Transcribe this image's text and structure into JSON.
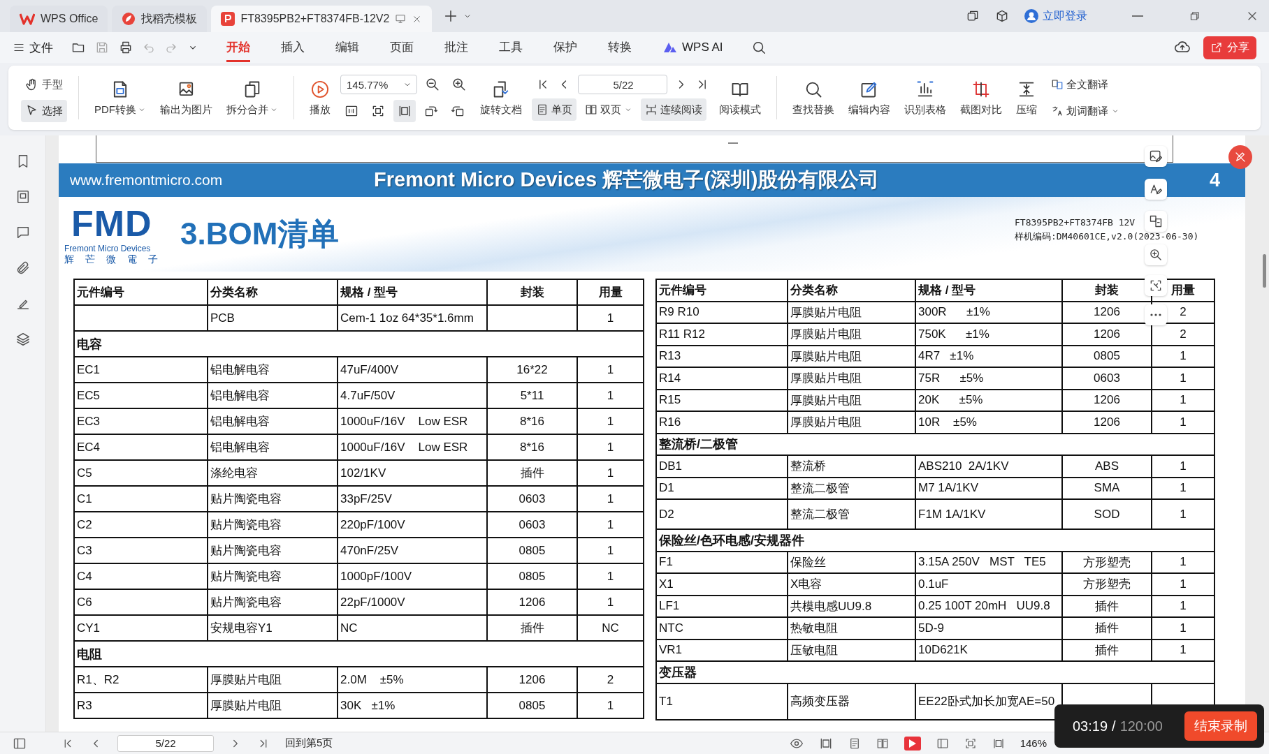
{
  "tabs": [
    {
      "label": "WPS Office",
      "kind": "home",
      "selected": false
    },
    {
      "label": "找稻壳模板",
      "kind": "template",
      "selected": false
    },
    {
      "label": "FT8395PB2+FT8374FB-12V2",
      "kind": "document",
      "selected": true
    }
  ],
  "account": "立即登录",
  "menu": {
    "file": "文件",
    "tabs": [
      {
        "label": "开始",
        "selected": true
      },
      {
        "label": "插入",
        "selected": false
      },
      {
        "label": "编辑",
        "selected": false
      },
      {
        "label": "页面",
        "selected": false
      },
      {
        "label": "批注",
        "selected": false
      },
      {
        "label": "工具",
        "selected": false
      },
      {
        "label": "保护",
        "selected": false
      },
      {
        "label": "转换",
        "selected": false
      }
    ],
    "ai": "WPS AI",
    "share": "分享"
  },
  "toolbar": {
    "pointer_tools": [
      {
        "label": "手型",
        "selected": false
      },
      {
        "label": "选择",
        "selected": true
      }
    ],
    "convert_tools": [
      {
        "label": "PDF转换",
        "dropdown": true
      },
      {
        "label": "输出为图片",
        "dropdown": false
      },
      {
        "label": "拆分合并",
        "dropdown": true
      }
    ],
    "play": "播放",
    "zoom": "145.77%",
    "fit_buttons": [
      {
        "selected": false
      },
      {
        "selected": false
      },
      {
        "selected": true
      },
      {
        "selected": false
      },
      {
        "selected": false
      }
    ],
    "rotate": "旋转文档",
    "page": "5/22",
    "view_modes": [
      {
        "label": "单页",
        "selected": true,
        "dropdown": false
      },
      {
        "label": "双页",
        "selected": false,
        "dropdown": true
      },
      {
        "label": "连续阅读",
        "selected": true,
        "dropdown": false
      }
    ],
    "reading_mode": "阅读模式",
    "edit_tools": [
      {
        "label": "查找替换"
      },
      {
        "label": "编辑内容"
      },
      {
        "label": "识别表格"
      },
      {
        "label": "截图对比"
      },
      {
        "label": "压缩"
      }
    ],
    "translate_tools": [
      {
        "label": "全文翻译",
        "dropdown": false
      },
      {
        "label": "划词翻译",
        "dropdown": true
      }
    ]
  },
  "document": {
    "website": "www.fremontmicro.com",
    "company": "Fremont Micro Devices 辉芒微电子(深圳)股份有限公司",
    "page_number": "4",
    "logo": {
      "mark": "FMD",
      "name": "Fremont Micro Devices",
      "chinese": "辉 芒 微 電 子"
    },
    "title": "3.BOM清单",
    "model": "FT8395PB2+FT8374FB 12V",
    "sample_code": "样机编码:DM40601CE,v2.0(2023-06-30)",
    "tables": [
      {
        "columns": [
          "元件编号",
          "分类名称",
          "规格 / 型号",
          "封装",
          "用量"
        ],
        "rows": [
          {
            "kind": "item",
            "cells": [
              "",
              "PCB",
              "Cem-1 1oz 64*35*1.6mm",
              "",
              "1"
            ]
          },
          {
            "kind": "section",
            "label": "电容"
          },
          {
            "kind": "item",
            "cells": [
              "EC1",
              "铝电解电容",
              "47uF/400V",
              "16*22",
              "1"
            ]
          },
          {
            "kind": "item",
            "cells": [
              "EC5",
              "铝电解电容",
              "4.7uF/50V",
              "5*11",
              "1"
            ]
          },
          {
            "kind": "item",
            "cells": [
              "EC3",
              "铝电解电容",
              "1000uF/16V    Low ESR",
              "8*16",
              "1"
            ]
          },
          {
            "kind": "item",
            "cells": [
              "EC4",
              "铝电解电容",
              "1000uF/16V    Low ESR",
              "8*16",
              "1"
            ]
          },
          {
            "kind": "item",
            "cells": [
              "C5",
              "涤纶电容",
              "102/1KV",
              "插件",
              "1"
            ]
          },
          {
            "kind": "item",
            "cells": [
              "C1",
              "贴片陶瓷电容",
              "33pF/25V",
              "0603",
              "1"
            ]
          },
          {
            "kind": "item",
            "cells": [
              "C2",
              "贴片陶瓷电容",
              "220pF/100V",
              "0603",
              "1"
            ]
          },
          {
            "kind": "item",
            "cells": [
              "C3",
              "贴片陶瓷电容",
              "470nF/25V",
              "0805",
              "1"
            ]
          },
          {
            "kind": "item",
            "cells": [
              "C4",
              "贴片陶瓷电容",
              "1000pF/100V",
              "0805",
              "1"
            ]
          },
          {
            "kind": "item",
            "cells": [
              "C6",
              "贴片陶瓷电容",
              "22pF/1000V",
              "1206",
              "1"
            ]
          },
          {
            "kind": "item",
            "cells": [
              "CY1",
              "安规电容Y1",
              "NC",
              "插件",
              "NC"
            ]
          },
          {
            "kind": "section",
            "label": "电阻"
          },
          {
            "kind": "item",
            "cells": [
              "R1、R2",
              "厚膜贴片电阻",
              "2.0M    ±5%",
              "1206",
              "2"
            ]
          },
          {
            "kind": "item",
            "cells": [
              "R3",
              "厚膜贴片电阻",
              "30K   ±1%",
              "0805",
              "1"
            ]
          }
        ]
      },
      {
        "columns": [
          "元件编号",
          "分类名称",
          "规格 / 型号",
          "封装",
          "用量"
        ],
        "rows": [
          {
            "kind": "item",
            "cells": [
              "R9 R10",
              "厚膜贴片电阻",
              "300R      ±1%",
              "1206",
              "2"
            ]
          },
          {
            "kind": "item",
            "cells": [
              "R11 R12",
              "厚膜贴片电阻",
              "750K      ±1%",
              "1206",
              "2"
            ]
          },
          {
            "kind": "item",
            "cells": [
              "R13",
              "厚膜贴片电阻",
              "4R7   ±1%",
              "0805",
              "1"
            ]
          },
          {
            "kind": "item",
            "cells": [
              "R14",
              "厚膜贴片电阻",
              "75R      ±5%",
              "0603",
              "1"
            ]
          },
          {
            "kind": "item",
            "cells": [
              "R15",
              "厚膜贴片电阻",
              "20K      ±5%",
              "1206",
              "1"
            ]
          },
          {
            "kind": "item",
            "cells": [
              "R16",
              "厚膜贴片电阻",
              "10R    ±5%",
              "1206",
              "1"
            ]
          },
          {
            "kind": "section",
            "label": "整流桥/二极管"
          },
          {
            "kind": "item",
            "cells": [
              "DB1",
              "整流桥",
              "ABS210  2A/1KV",
              "ABS",
              "1"
            ]
          },
          {
            "kind": "item",
            "cells": [
              "D1",
              "整流二极管",
              "M7 1A/1KV",
              "SMA",
              "1"
            ]
          },
          {
            "kind": "item",
            "cells": [
              "D2",
              "整流二极管",
              "F1M 1A/1KV",
              "SOD",
              "1"
            ]
          },
          {
            "kind": "section",
            "label": "保险丝/色环电感/安规器件"
          },
          {
            "kind": "item",
            "cells": [
              "F1",
              "保险丝",
              "3.15A 250V   MST   TE5",
              "方形塑壳",
              "1"
            ]
          },
          {
            "kind": "item",
            "cells": [
              "X1",
              "X电容",
              "0.1uF",
              "方形塑壳",
              "1"
            ]
          },
          {
            "kind": "item",
            "cells": [
              "LF1",
              "共模电感UU9.8",
              "0.25 100T 20mH   UU9.8",
              "插件",
              "1"
            ]
          },
          {
            "kind": "item",
            "cells": [
              "NTC",
              "热敏电阻",
              "5D-9",
              "插件",
              "1"
            ]
          },
          {
            "kind": "item",
            "cells": [
              "VR1",
              "压敏电阻",
              "10D621K",
              "插件",
              "1"
            ]
          },
          {
            "kind": "section",
            "label": "变压器"
          },
          {
            "kind": "item",
            "cells": [
              "T1",
              "高频变压器",
              "EE22卧式加长加宽AE=50"
            ]
          }
        ]
      }
    ]
  },
  "status_bar": {
    "page": "5/22",
    "back": "回到第5页",
    "zoom": "146%"
  },
  "recording": {
    "elapsed": "03:19",
    "separator": "/",
    "limit": "120:00",
    "stop": "结束录制"
  }
}
